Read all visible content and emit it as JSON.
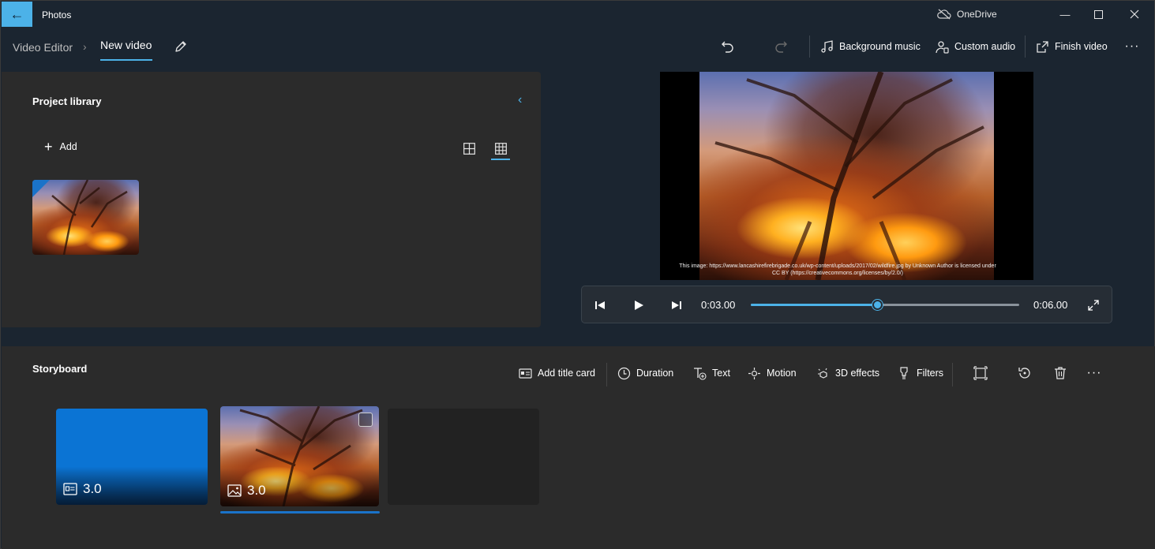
{
  "window": {
    "app_title": "Photos",
    "onedrive_label": "OneDrive",
    "back_icon": "arrow-left-icon"
  },
  "breadcrumb": {
    "parent": "Video Editor",
    "current": "New video"
  },
  "commands": {
    "background_music": "Background music",
    "custom_audio": "Custom audio",
    "finish_video": "Finish video"
  },
  "library": {
    "title": "Project library",
    "add_label": "Add"
  },
  "preview": {
    "caption": "This image: https://www.lancashirefirebrigade.co.uk/wp-content/uploads/2017/02/wildfire.jpg by Unknown Author is licensed under CC BY (https://creativecommons.org/licenses/by/2.0/)"
  },
  "player": {
    "current_time": "0:03.00",
    "total_time": "0:06.00",
    "progress": 0.47
  },
  "storyboard": {
    "title": "Storyboard",
    "add_title_card": "Add title card",
    "duration": "Duration",
    "text": "Text",
    "motion": "Motion",
    "effects_3d": "3D effects",
    "filters": "Filters",
    "clips": [
      {
        "kind": "title-card",
        "duration": "3.0"
      },
      {
        "kind": "image",
        "duration": "3.0"
      }
    ]
  },
  "colors": {
    "accent": "#4cb2e8",
    "selection": "#1a73c9",
    "title_card": "#0b74d4"
  }
}
